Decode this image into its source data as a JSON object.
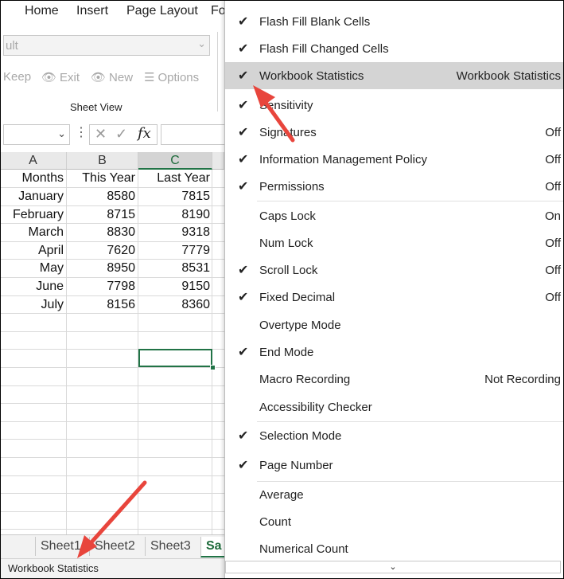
{
  "ribbon": {
    "tabs": [
      "Home",
      "Insert",
      "Page Layout",
      "Fo"
    ],
    "sheet_view": {
      "select_value": "ult",
      "keep_label": "Keep",
      "exit_label": "Exit",
      "new_label": "New",
      "options_label": "Options",
      "group_label": "Sheet View"
    }
  },
  "formula_bar": {
    "fx_label": "fx"
  },
  "grid": {
    "columns": [
      "A",
      "B",
      "C"
    ],
    "selected_column": "C",
    "headers": [
      "Months",
      "This Year",
      "Last Year"
    ],
    "rows": [
      [
        "January",
        "8580",
        "7815"
      ],
      [
        "February",
        "8715",
        "8190"
      ],
      [
        "March",
        "8830",
        "9318"
      ],
      [
        "April",
        "7620",
        "7779"
      ],
      [
        "May",
        "8950",
        "8531"
      ],
      [
        "June",
        "7798",
        "9150"
      ],
      [
        "July",
        "8156",
        "8360"
      ]
    ]
  },
  "sheet_tabs": [
    "Sheet1",
    "Sheet2",
    "Sheet3",
    "Sa"
  ],
  "active_sheet_tab": "Sa",
  "status_bar": {
    "text": "Workbook Statistics"
  },
  "context_menu": {
    "items": [
      {
        "label": "Flash Fill Blank Cells",
        "checked": true,
        "value": ""
      },
      {
        "label": "Flash Fill Changed Cells",
        "checked": true,
        "value": ""
      },
      {
        "label": "Workbook Statistics",
        "checked": true,
        "value": "Workbook Statistics",
        "highlighted": true
      },
      {
        "label": "Sensitivity",
        "checked": true,
        "value": ""
      },
      {
        "label": "Signatures",
        "checked": true,
        "value": "Off"
      },
      {
        "label": "Information Management Policy",
        "checked": true,
        "value": "Off"
      },
      {
        "label": "Permissions",
        "checked": true,
        "value": "Off"
      },
      {
        "label": "Caps Lock",
        "checked": false,
        "value": "On"
      },
      {
        "label": "Num Lock",
        "checked": false,
        "value": "Off"
      },
      {
        "label": "Scroll Lock",
        "checked": true,
        "value": "Off"
      },
      {
        "label": "Fixed Decimal",
        "checked": true,
        "value": "Off"
      },
      {
        "label": "Overtype Mode",
        "checked": false,
        "value": ""
      },
      {
        "label": "End Mode",
        "checked": true,
        "value": ""
      },
      {
        "label": "Macro Recording",
        "checked": false,
        "value": "Not Recording"
      },
      {
        "label": "Accessibility Checker",
        "checked": false,
        "value": ""
      },
      {
        "label": "Selection Mode",
        "checked": true,
        "value": ""
      },
      {
        "label": "Page Number",
        "checked": true,
        "value": ""
      },
      {
        "label": "Average",
        "checked": false,
        "value": ""
      },
      {
        "label": "Count",
        "checked": false,
        "value": ""
      },
      {
        "label": "Numerical Count",
        "checked": false,
        "value": ""
      }
    ],
    "check_glyph": "✔"
  },
  "colors": {
    "excel_green": "#217346",
    "menu_highlight": "#d4d4d4",
    "annotation_arrow": "#e8453c"
  }
}
